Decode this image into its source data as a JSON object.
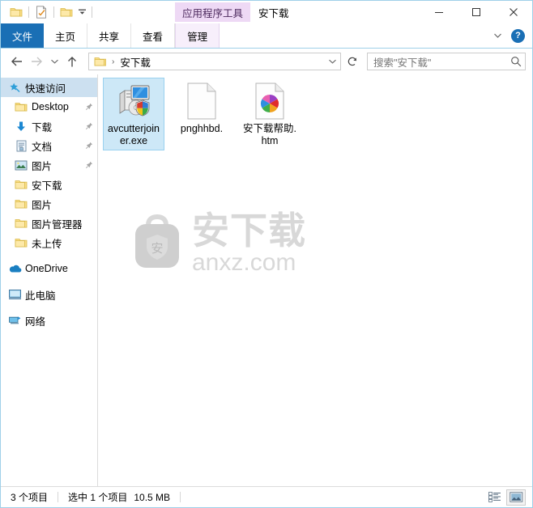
{
  "window": {
    "title": "安下载",
    "contextual_tab_header": "应用程序工具",
    "controls": {
      "minimize": "—",
      "maximize": "□",
      "close": "✕"
    }
  },
  "quick_access_toolbar": {
    "items": [
      {
        "name": "folder-icon",
        "label": ""
      },
      {
        "name": "properties-icon",
        "label": ""
      },
      {
        "name": "new-folder-icon",
        "label": ""
      }
    ],
    "dropdown": "▾"
  },
  "ribbon": {
    "tabs": [
      {
        "label": "文件",
        "active_file": true
      },
      {
        "label": "主页",
        "active_file": false
      },
      {
        "label": "共享",
        "active_file": false
      },
      {
        "label": "查看",
        "active_file": false
      },
      {
        "label": "管理",
        "active_file": false,
        "contextual": true
      }
    ],
    "collapse_icon": "⌄",
    "help_label": "?"
  },
  "address_bar": {
    "back": "←",
    "forward": "→",
    "recent": "⌄",
    "up": "↑",
    "breadcrumb": [
      {
        "label": "安下载"
      }
    ],
    "breadcrumb_separator": "›",
    "dropdown": "⌄",
    "refresh": "↻"
  },
  "search": {
    "placeholder": "搜索\"安下载\"",
    "icon": "search-icon"
  },
  "sidebar": {
    "items": [
      {
        "label": "快速访问",
        "icon": "star-pin-icon",
        "selected": true,
        "pinned": false,
        "indent": false
      },
      {
        "label": "Desktop",
        "icon": "folder-icon",
        "selected": false,
        "pinned": true,
        "indent": true
      },
      {
        "label": "下载",
        "icon": "download-icon",
        "selected": false,
        "pinned": true,
        "indent": true
      },
      {
        "label": "文档",
        "icon": "documents-icon",
        "selected": false,
        "pinned": true,
        "indent": true
      },
      {
        "label": "图片",
        "icon": "pictures-icon",
        "selected": false,
        "pinned": true,
        "indent": true
      },
      {
        "label": "安下载",
        "icon": "folder-icon",
        "selected": false,
        "pinned": false,
        "indent": true
      },
      {
        "label": "图片",
        "icon": "folder-icon",
        "selected": false,
        "pinned": false,
        "indent": true
      },
      {
        "label": "图片管理器",
        "icon": "folder-icon",
        "selected": false,
        "pinned": false,
        "indent": true
      },
      {
        "label": "未上传",
        "icon": "folder-icon",
        "selected": false,
        "pinned": false,
        "indent": true
      },
      {
        "label": "OneDrive",
        "icon": "onedrive-icon",
        "selected": false,
        "pinned": false,
        "indent": false
      },
      {
        "label": "此电脑",
        "icon": "this-pc-icon",
        "selected": false,
        "pinned": false,
        "indent": false
      },
      {
        "label": "网络",
        "icon": "network-icon",
        "selected": false,
        "pinned": false,
        "indent": false
      }
    ]
  },
  "files": [
    {
      "name": "avcutterjoiner.exe",
      "icon": "exe-installer-icon",
      "selected": true
    },
    {
      "name": "pnghhbd.",
      "icon": "blank-document-icon",
      "selected": false
    },
    {
      "name": "安下载帮助.htm",
      "icon": "html-document-icon",
      "selected": false
    }
  ],
  "watermark": {
    "cn": "安下载",
    "en": "anxz.com",
    "logo_char": "安",
    "color": "#d8d8d8"
  },
  "status_bar": {
    "item_count": "3 个项目",
    "selection": "选中 1 个项目",
    "size": "10.5 MB",
    "views": [
      {
        "name": "details-view-button",
        "active": false
      },
      {
        "name": "large-icons-view-button",
        "active": true
      }
    ]
  },
  "colors": {
    "accent": "#1a6fb5",
    "contextual": "#eed9f5",
    "selection": "#cde8f7",
    "nav_selection": "#cce0f0",
    "window_border": "#9fd0e8"
  }
}
